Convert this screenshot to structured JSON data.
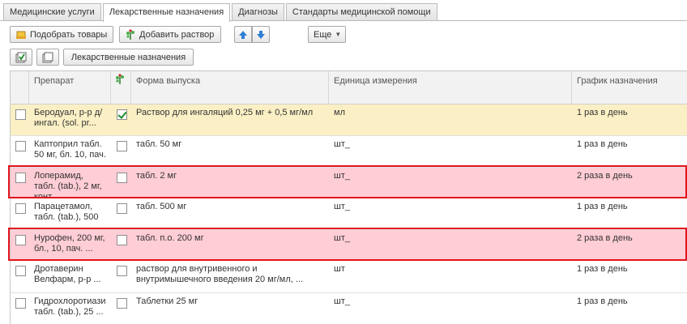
{
  "tabs": [
    {
      "label": "Медицинские услуги",
      "active": false
    },
    {
      "label": "Лекарственные назначения",
      "active": true
    },
    {
      "label": "Диагнозы",
      "active": false
    },
    {
      "label": "Стандарты медицинской помощи",
      "active": false
    }
  ],
  "toolbar": {
    "pick_goods": "Подобрать товары",
    "add_solution": "Добавить раствор",
    "more": "Еще",
    "drug_prescriptions": "Лекарственные назначения"
  },
  "table": {
    "columns": {
      "drug": "Препарат",
      "form": "Форма выпуска",
      "unit": "Единица измерения",
      "schedule": "График назначения"
    },
    "rows": [
      {
        "drug": "Беродуал, р-р д/ингал. (sol. pr...",
        "solution": true,
        "form": "Раствор для ингаляций 0,25 мг + 0,5 мг/мл",
        "unit": "мл",
        "schedule": "1 раз в день",
        "state": "selected"
      },
      {
        "drug": "Каптоприл табл. 50 мг, бл. 10, пач.",
        "solution": false,
        "form": "табл. 50 мг",
        "unit": "шт_",
        "schedule": "1 раз в день",
        "state": "normal"
      },
      {
        "drug": "Лоперамид, табл. (tab.), 2 мг, конт...",
        "solution": false,
        "form": "табл. 2 мг",
        "unit": "шт_",
        "schedule": "2 раза в день",
        "state": "error"
      },
      {
        "drug": "Парацетамол, табл. (tab.), 500 ...",
        "solution": false,
        "form": "табл. 500 мг",
        "unit": "шт_",
        "schedule": "1 раз в день",
        "state": "normal"
      },
      {
        "drug": "Нурофен, 200 мг, бл., 10, пач. ...",
        "solution": false,
        "form": "табл. п.о. 200 мг",
        "unit": "шт_",
        "schedule": "2 раза в день",
        "state": "error"
      },
      {
        "drug": "Дротаверин Велфарм, р-р ...",
        "solution": false,
        "form": "раствор для внутривенного и внутримышечного введения 20 мг/мл, ...",
        "unit": "шт",
        "schedule": "1 раз в день",
        "state": "normal"
      },
      {
        "drug": "Гидрохлоротиази табл. (tab.), 25 ...",
        "solution": false,
        "form": "Таблетки 25 мг",
        "unit": "шт_",
        "schedule": "1 раз в день",
        "state": "normal"
      }
    ]
  },
  "colors": {
    "selected_row": "#fbf0c5",
    "error_row": "#ffcdd6",
    "error_border": "#e4141c"
  },
  "icons": [
    "cart-hand-icon",
    "plant-icon",
    "arrow-up-icon",
    "arrow-down-icon",
    "chevron-down-icon",
    "check-all-icon",
    "copy-icon"
  ]
}
